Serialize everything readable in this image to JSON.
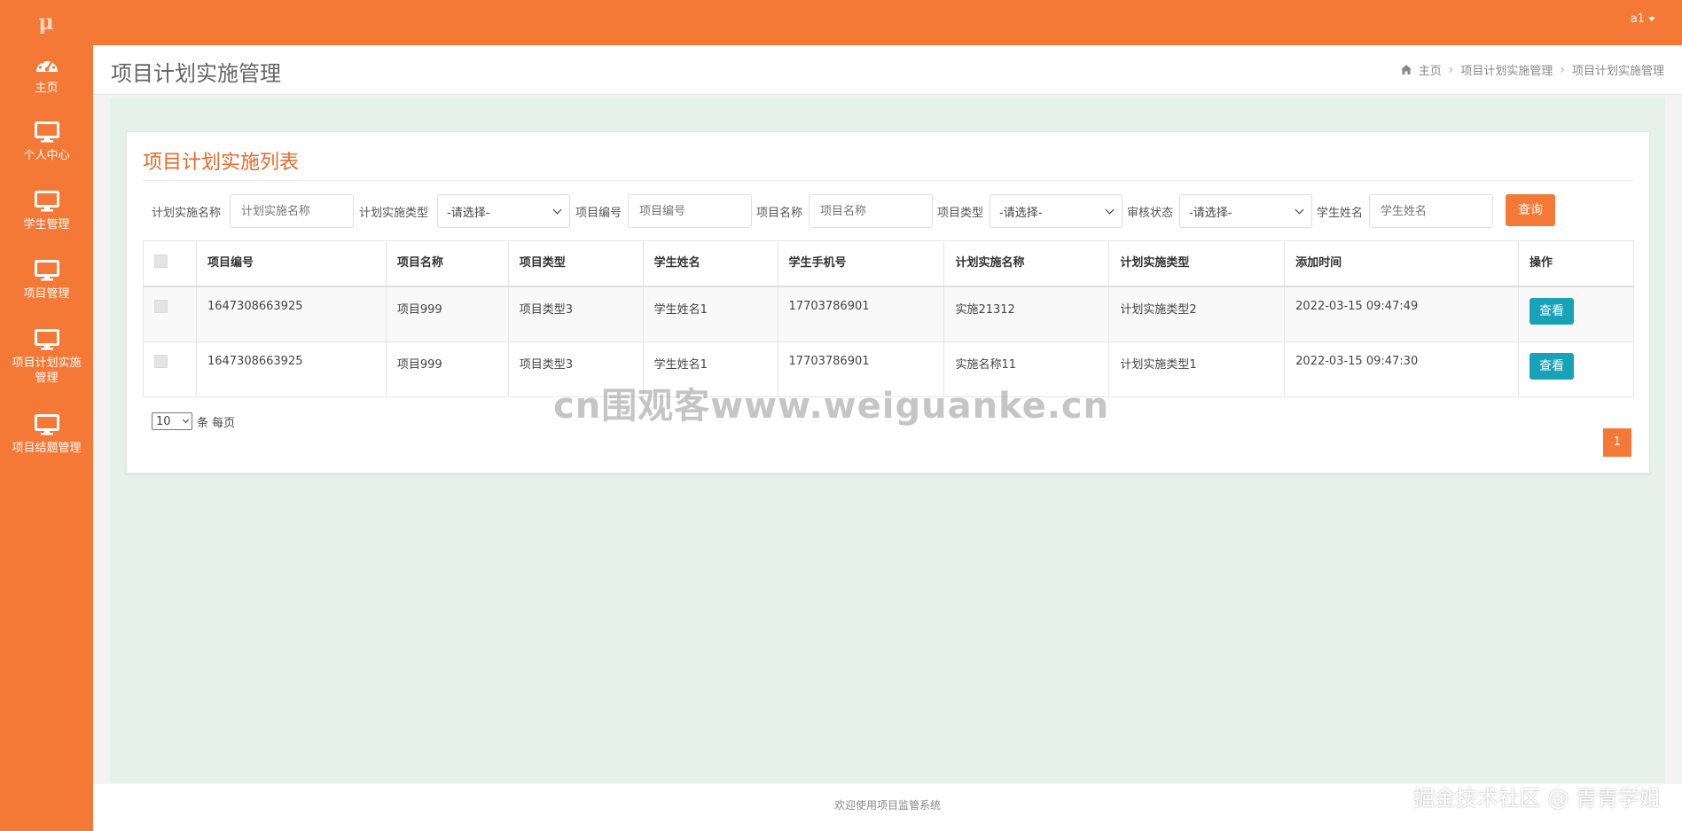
{
  "topbar": {
    "logo": "μ",
    "user": "a1"
  },
  "sidebar": {
    "items": [
      {
        "label": "主页",
        "icon": "dashboard-icon"
      },
      {
        "label": "个人中心",
        "icon": "monitor-icon"
      },
      {
        "label": "学生管理",
        "icon": "monitor-icon"
      },
      {
        "label": "项目管理",
        "icon": "monitor-icon"
      },
      {
        "label": "项目计划实施管理",
        "icon": "monitor-icon"
      },
      {
        "label": "项目结题管理",
        "icon": "monitor-icon"
      }
    ]
  },
  "header": {
    "title": "项目计划实施管理",
    "breadcrumb": [
      "主页",
      "项目计划实施管理",
      "项目计划实施管理"
    ]
  },
  "card": {
    "title": "项目计划实施列表"
  },
  "filters": {
    "plan_name": {
      "label": "计划实施名称",
      "placeholder": "计划实施名称"
    },
    "plan_type": {
      "label": "计划实施类型",
      "value": "-请选择-"
    },
    "project_no": {
      "label": "项目编号",
      "placeholder": "项目编号"
    },
    "project_name": {
      "label": "项目名称",
      "placeholder": "项目名称"
    },
    "project_type": {
      "label": "项目类型",
      "value": "-请选择-"
    },
    "audit_status": {
      "label": "审核状态",
      "value": "-请选择-"
    },
    "student_name": {
      "label": "学生姓名",
      "placeholder": "学生姓名"
    },
    "search_label": "查询"
  },
  "table": {
    "columns": [
      "项目编号",
      "项目名称",
      "项目类型",
      "学生姓名",
      "学生手机号",
      "计划实施名称",
      "计划实施类型",
      "添加时间",
      "操作"
    ],
    "rows": [
      {
        "project_no": "1647308663925",
        "project_name": "项目999",
        "project_type": "项目类型3",
        "student_name": "学生姓名1",
        "phone": "17703786901",
        "plan_name": "实施21312",
        "plan_type": "计划实施类型2",
        "added": "2022-03-15 09:47:49",
        "action": "查看"
      },
      {
        "project_no": "1647308663925",
        "project_name": "项目999",
        "project_type": "项目类型3",
        "student_name": "学生姓名1",
        "phone": "17703786901",
        "plan_name": "实施名称11",
        "plan_type": "计划实施类型1",
        "added": "2022-03-15 09:47:30",
        "action": "查看"
      }
    ]
  },
  "pagination": {
    "page_size": "10",
    "per_page_label": "条 每页",
    "current_page": "1"
  },
  "footer": {
    "text": "欢迎使用项目监管系统"
  },
  "watermarks": {
    "center": "cn围观客www.weiguanke.cn",
    "corner": "掘金技术社区 @ 青青学姐"
  }
}
